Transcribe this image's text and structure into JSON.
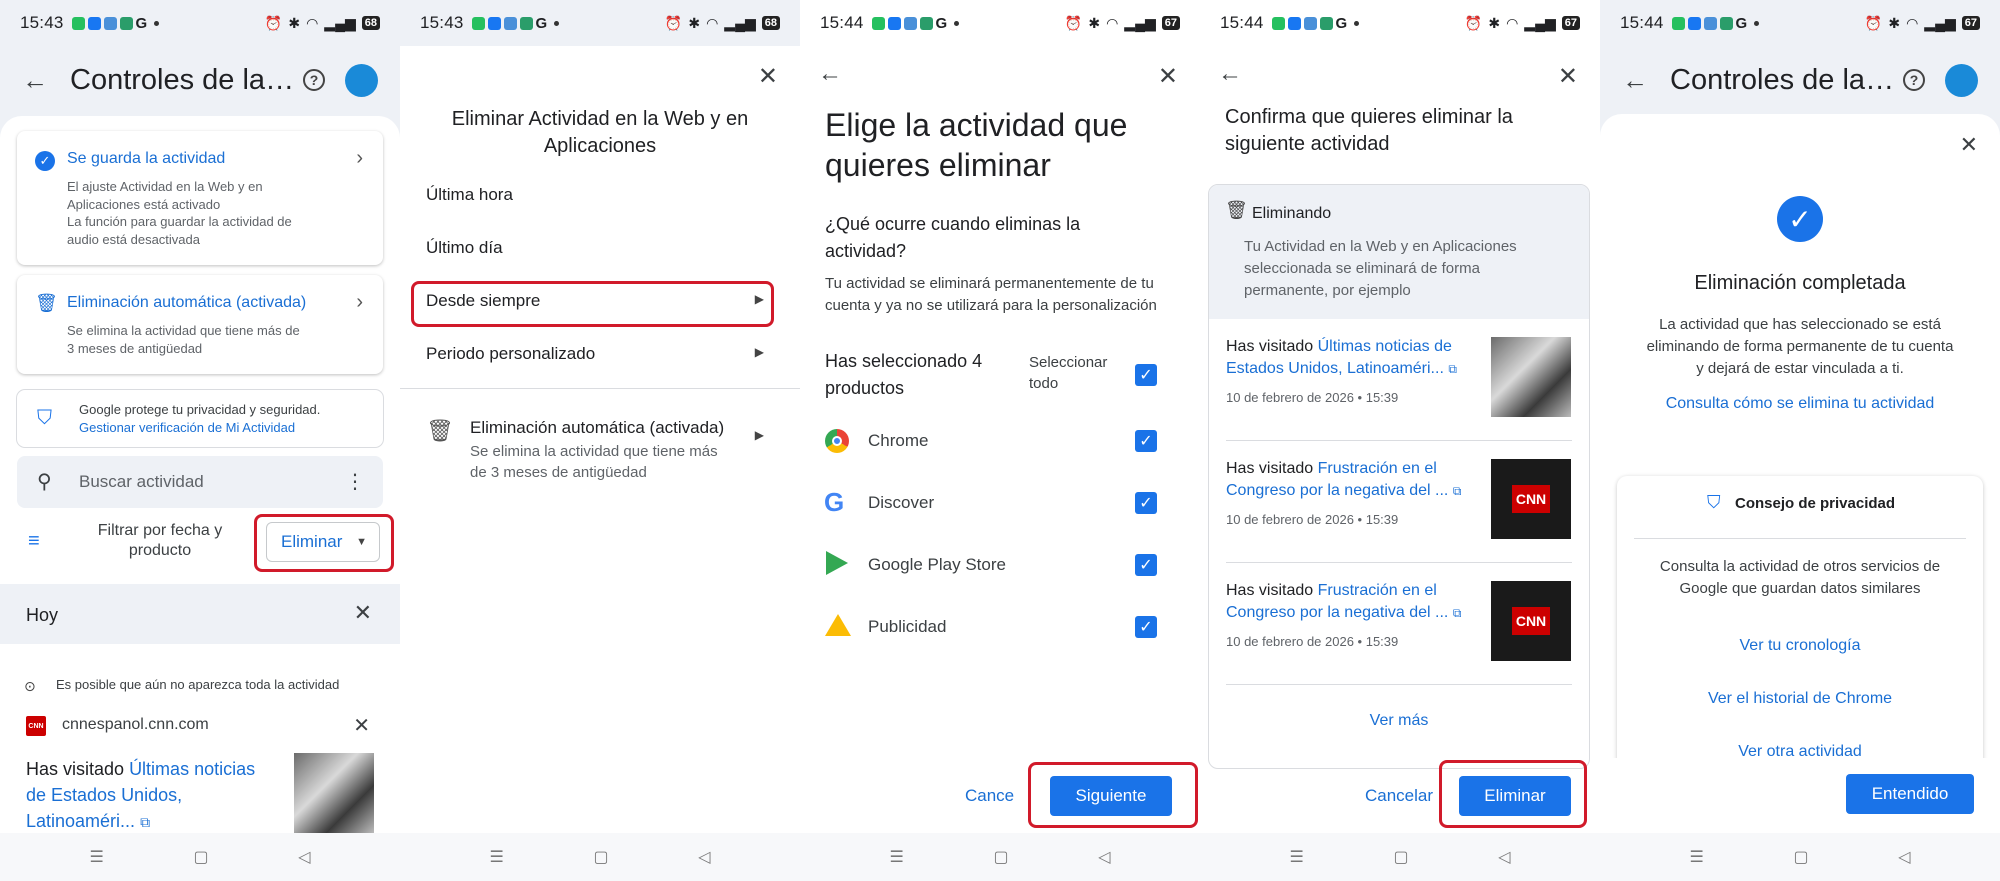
{
  "colors": {
    "accent": "#1a73e8",
    "highlight": "#d11a2a",
    "avatar": "#1a8ad8"
  },
  "panel1": {
    "status": {
      "time": "15:43",
      "battery": "68"
    },
    "title": "Controles de la ac...",
    "cards": [
      {
        "title": "Se guarda la actividad",
        "lines": [
          "El ajuste Actividad en la Web y en",
          "Aplicaciones está activado",
          "La función para guardar la actividad de",
          "audio está desactivada"
        ]
      },
      {
        "title": "Eliminación automática (activada)",
        "lines": [
          "Se elimina la actividad que tiene más de",
          "3 meses de antigüedad"
        ]
      }
    ],
    "privacy": {
      "text": "Google protege tu privacidad y seguridad.",
      "link": "Gestionar verificación de Mi Actividad"
    },
    "search_placeholder": "Buscar actividad",
    "filter_label": "Filtrar por fecha y producto",
    "delete_label": "Eliminar",
    "today_label": "Hoy",
    "notice": "Es posible que aún no aparezca toda la actividad",
    "site": "cnnespanol.cnn.com",
    "site_icon": "CNN",
    "visited_prefix": "Has visitado",
    "visited_link": "Últimas noticias de Estados Unidos, Latinoaméri..."
  },
  "panel2": {
    "status": {
      "time": "15:43",
      "battery": "68"
    },
    "heading": "Eliminar Actividad en la Web y en Aplicaciones",
    "options": [
      "Última hora",
      "Último día",
      "Desde siempre",
      "Periodo personalizado"
    ],
    "auto_title": "Eliminación automática (activada)",
    "auto_sub": "Se elimina la actividad que tiene más de 3 meses de antigüedad"
  },
  "panel3": {
    "status": {
      "time": "15:44",
      "battery": "67"
    },
    "heading": "Elige la actividad que quieres eliminar",
    "question": "¿Qué ocurre cuando eliminas la actividad?",
    "explanation": "Tu actividad se eliminará permanentemente de tu cuenta y ya no se utilizará para la personalización",
    "selected": "Has seleccionado 4 productos",
    "select_all": "Seleccionar todo",
    "products": [
      "Chrome",
      "Discover",
      "Google Play Store",
      "Publicidad"
    ],
    "cancel": "Cancelar",
    "next": "Siguiente"
  },
  "panel4": {
    "status": {
      "time": "15:44",
      "battery": "67"
    },
    "heading": "Confirma que quieres eliminar la siguiente actividad",
    "deleting_title": "Eliminando",
    "deleting_text": "Tu Actividad en la Web y en Aplicaciones seleccionada se eliminará de forma permanente, por ejemplo",
    "items": [
      {
        "prefix": "Has visitado",
        "link": "Últimas noticias de Estados Unidos, Latinoaméri...",
        "date": "10 de febrero de 2026 • 15:39",
        "thumb": "photo"
      },
      {
        "prefix": "Has visitado",
        "link": "Frustración en el Congreso por la negativa del ...",
        "date": "10 de febrero de 2026 • 15:39",
        "thumb": "CNN"
      },
      {
        "prefix": "Has visitado",
        "link": "Frustración en el Congreso por la negativa del ...",
        "date": "10 de febrero de 2026 • 15:39",
        "thumb": "CNN"
      }
    ],
    "more": "Ver más",
    "cancel": "Cancelar",
    "delete": "Eliminar"
  },
  "panel5": {
    "status": {
      "time": "15:44",
      "battery": "67"
    },
    "title": "Controles de la ac...",
    "done_title": "Eliminación completada",
    "done_text": "La actividad que has seleccionado se está eliminando de forma permanente de tu cuenta y dejará de estar vinculada a ti.",
    "done_link": "Consulta cómo se elimina tu actividad",
    "tip_title": "Consejo de privacidad",
    "tip_text": "Consulta la actividad de otros servicios de Google que guardan datos similares",
    "tip_links": [
      "Ver tu cronología",
      "Ver el historial de Chrome",
      "Ver otra actividad"
    ],
    "ok": "Entendido"
  }
}
